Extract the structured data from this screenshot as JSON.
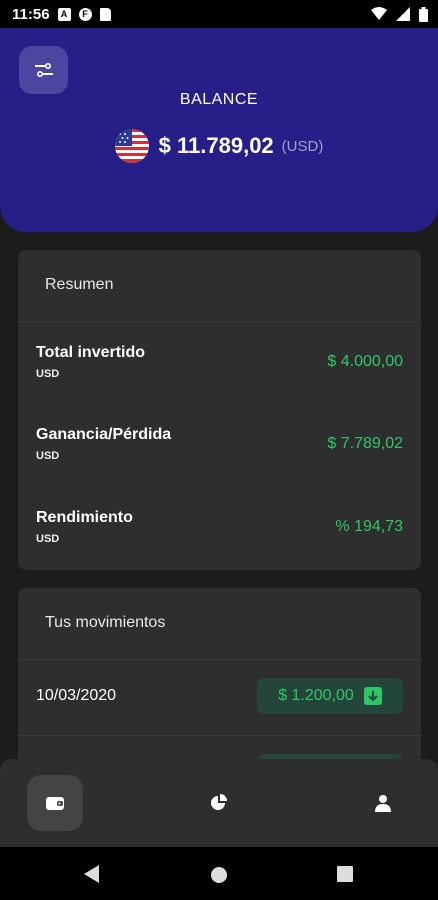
{
  "status_bar": {
    "time": "11:56",
    "icons": [
      "a-notification-icon",
      "f-notification-icon",
      "sd-card-icon",
      "wifi-icon",
      "signal-icon",
      "battery-icon"
    ]
  },
  "header": {
    "title": "BALANCE",
    "amount": "$ 11.789,02",
    "currency": "(USD)",
    "flag": "us-flag-icon",
    "background_color": "#251f87"
  },
  "summary": {
    "title": "Resumen",
    "rows": [
      {
        "label": "Total invertido",
        "sub": "USD",
        "value": "$ 4.000,00"
      },
      {
        "label": "Ganancia/Pérdida",
        "sub": "USD",
        "value": "$ 7.789,02"
      },
      {
        "label": "Rendimiento",
        "sub": "USD",
        "value": "% 194,73"
      }
    ]
  },
  "movements": {
    "title": "Tus movimientos",
    "items": [
      {
        "date": "10/03/2020",
        "amount": "$ 1.200,00",
        "icon": "arrow-down-icon"
      }
    ]
  },
  "bottom_nav": {
    "items": [
      "wallet-icon",
      "pie-chart-icon",
      "user-icon"
    ],
    "active_index": 0
  },
  "colors": {
    "accent_green": "#2ec766",
    "card_bg": "#2e2e2e",
    "page_bg": "#1c1c1c"
  }
}
